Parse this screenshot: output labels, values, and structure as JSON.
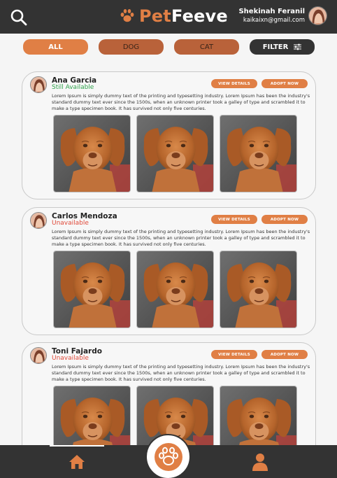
{
  "header": {
    "brand_prefix": "Pet",
    "brand_suffix": "Feeve",
    "user_name": "Shekinah Feranil",
    "user_email": "kaikaixn@gmail.com"
  },
  "filters": {
    "all": "ALL",
    "dog": "DOG",
    "cat": "CAT",
    "filter": "FILTER"
  },
  "buttons": {
    "view_details": "VIEW DETAILS",
    "adopt_now": "ADOPT NOW"
  },
  "pets": [
    {
      "owner": "Ana Garcia",
      "status": "Still Available",
      "description": "Lorem Ipsum is simply dummy text of the printing and typesetting industry. Lorem Ipsum has been the industry's standard dummy text ever since the 1500s, when an unknown printer took a galley of type and scrambled it to make a type specimen book. It has survived not only five centuries."
    },
    {
      "owner": "Carlos Mendoza",
      "status": "Unavailable",
      "description": "Lorem Ipsum is simply dummy text of the printing and typesetting industry. Lorem Ipsum has been the industry's standard dummy text ever since the 1500s, when an unknown printer took a galley of type and scrambled it to make a type specimen book. It has survived not only five centuries."
    },
    {
      "owner": "Toni Fajardo",
      "status": "Unavailable",
      "description": "Lorem Ipsum is simply dummy text of the printing and typesetting industry. Lorem Ipsum has been the industry's standard dummy text ever since the 1500s, when an unknown printer took a galley of type and scrambled it to make a type specimen book. It has survived not only five centuries."
    }
  ],
  "icons": {
    "search": "search-icon",
    "paw": "paw-icon",
    "sliders": "sliders-icon",
    "home": "home-icon",
    "profile": "person-icon"
  },
  "colors": {
    "accent": "#e07f45",
    "accent_dark": "#b9623a",
    "dark": "#333333",
    "available": "#2fa24c",
    "unavailable": "#e04a3a"
  }
}
